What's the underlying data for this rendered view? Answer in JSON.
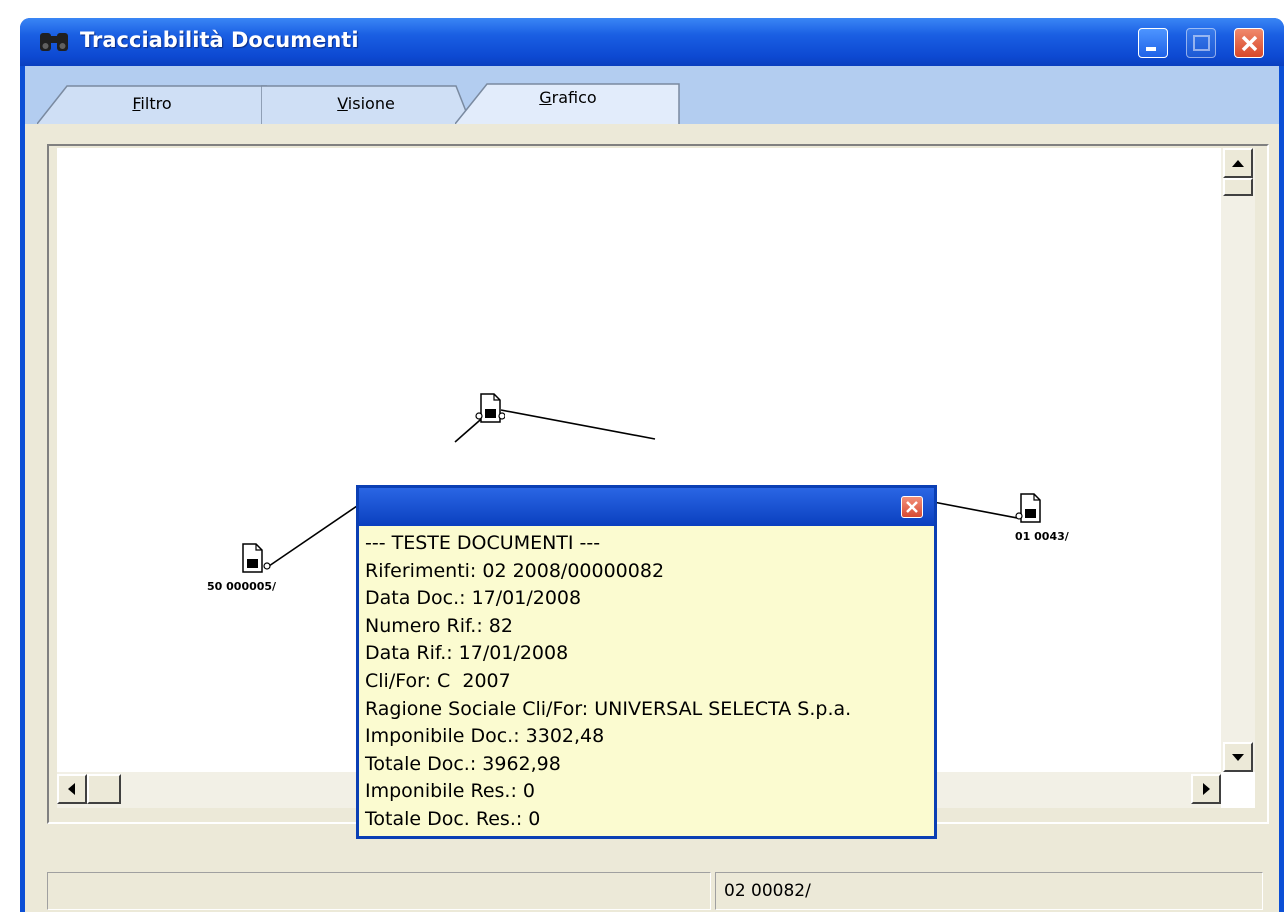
{
  "window": {
    "title": "Tracciabilità Documenti",
    "icon": "binoculars-icon"
  },
  "tabs": [
    {
      "label": "Filtro",
      "active": false
    },
    {
      "label": "Visione",
      "active": false
    },
    {
      "label": "Grafico",
      "active": true
    }
  ],
  "graph": {
    "nodes": [
      {
        "id": "center",
        "label": ""
      },
      {
        "id": "left",
        "label": "50 000005/"
      },
      {
        "id": "right",
        "label": "01 0043/"
      }
    ]
  },
  "popup": {
    "lines": [
      "--- TESTE DOCUMENTI ---",
      "Riferimenti: 02 2008/00000082",
      "Data Doc.: 17/01/2008",
      "Numero Rif.: 82",
      "Data Rif.: 17/01/2008",
      "Cli/For: C  2007",
      "Ragione Sociale Cli/For: UNIVERSAL SELECTA S.p.a.",
      "Imponibile Doc.: 3302,48",
      "Totale Doc.: 3962,98",
      "Imponibile Res.: 0",
      "Totale Doc. Res.: 0"
    ]
  },
  "status": {
    "left": "",
    "right": "02 00082/"
  },
  "colors": {
    "titlebar": "#0d49d2",
    "tabstrip": "#b3cdf0",
    "popup_bg": "#fbfbd0"
  }
}
